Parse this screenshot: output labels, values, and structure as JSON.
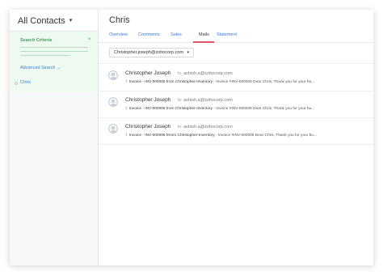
{
  "sidebar": {
    "header_title": "All Contacts",
    "header_caret": "▾",
    "search_criteria_label": "Search Criteria",
    "close_glyph": "×",
    "advanced_search_label": "Advanced Search",
    "advanced_search_arrow": "→",
    "contact_name": "Chris"
  },
  "main": {
    "title": "Chris",
    "tabs": [
      {
        "label": "Overview",
        "active": false
      },
      {
        "label": "Comments",
        "active": false
      },
      {
        "label": "Sales",
        "active": false
      },
      {
        "label": "Mails",
        "active": true
      },
      {
        "label": "Statement",
        "active": false
      }
    ],
    "email_filter": {
      "value": "Christopher.joseph@zohocorp.com",
      "caret": "▾"
    },
    "mails": [
      {
        "sender": "Christopher Joseph",
        "to_prefix": "to",
        "to_address": "ashish.a@zohocorp.com",
        "attachment_glyph": "⌇",
        "subject": "Invoice - INV-000006 from Christopher-Inventory",
        "preview": " - Invoice #INV-000006 Dear Chris, Thank you for your bu..."
      },
      {
        "sender": "Christopher Joseph",
        "to_prefix": "to",
        "to_address": "ashish.a@zohocorp.com",
        "attachment_glyph": "⌇",
        "subject": "Invoice - INV-000006 from Christopher-Inventory",
        "preview": " - Invoice #INV-000006 Dear Chris, Thank you for your bu..."
      },
      {
        "sender": "Christopher Joseph",
        "to_prefix": "to",
        "to_address": "ashish.a@zohocorp.com",
        "attachment_glyph": "⌇",
        "subject": "Invoice - INV-000006 fe­rom Christopher-Inventory",
        "preview": " - Invoice #INV-000006 Dear Chris, Thank you for your bu..."
      }
    ]
  },
  "colors": {
    "accent": "#3a7bd5",
    "green": "#3da35d",
    "active_tab_underline": "#e0536a"
  }
}
